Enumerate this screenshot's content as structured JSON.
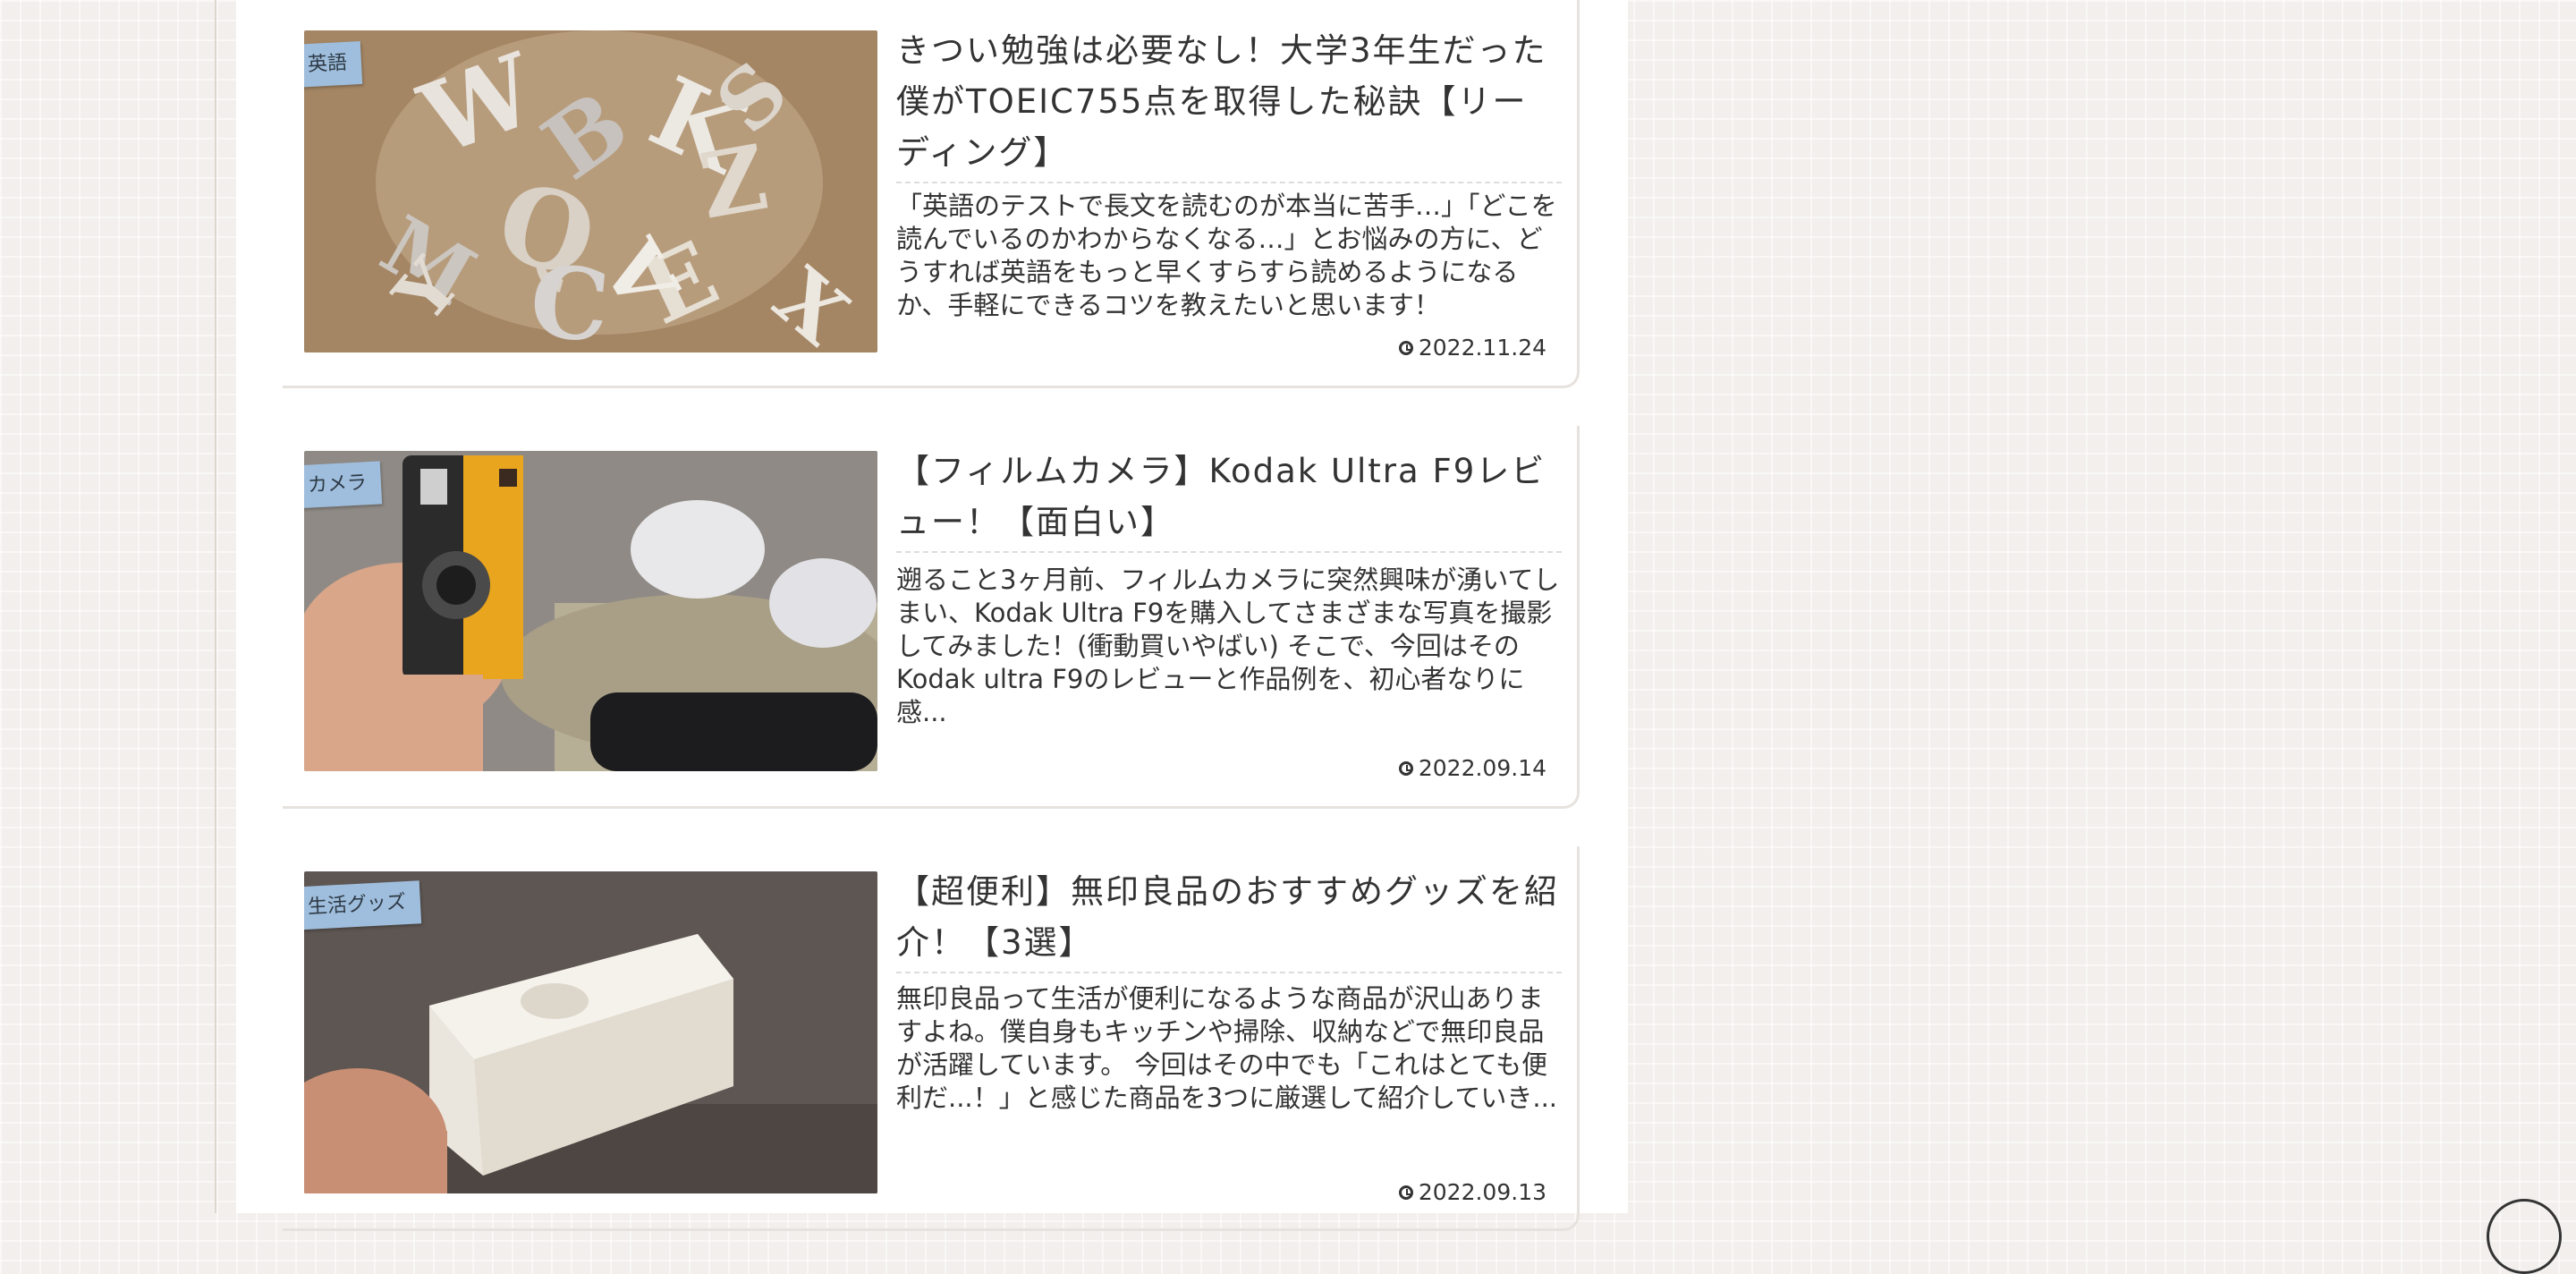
{
  "posts": [
    {
      "category": "英語",
      "title": "きつい勉強は必要なし！大学3年生だった僕がTOEIC755点を取得した秘訣【リーディング】",
      "snippet": "「英語のテストで長文を読むのが本当に苦手…」「どこを読んでいるのかわからなくなる…」とお悩みの方に、どうすれば英語をもっと早くすらすら読めるようになるか、手軽にできるコツを教えたいと思います！",
      "date": "2022.11.24",
      "image": "wooden-letters"
    },
    {
      "category": "カメラ",
      "title": "【フィルムカメラ】Kodak Ultra F9レビュー！【面白い】",
      "snippet": "遡ること3ヶ月前、フィルムカメラに突然興味が湧いてしまい、Kodak Ultra F9を購入してさまざまな写真を撮影してみました！(衝動買いやばい) そこで、今回はその Kodak ultra F9のレビューと作品例を、初心者なりに感...",
      "date": "2022.09.14",
      "image": "hand-holding-yellow-camera"
    },
    {
      "category": "生活グッズ",
      "title": "【超便利】無印良品のおすすめグッズを紹介！【3選】",
      "snippet": "無印良品って生活が便利になるような商品が沢山ありますよね。僕自身もキッチンや掃除、収納などで無印良品が活躍しています。 今回はその中でも「これはとても便利だ...！」と感じた商品を3つに厳選して紹介していき...",
      "date": "2022.09.13",
      "image": "white-storage-container"
    }
  ],
  "icons": {
    "date": "clock-icon",
    "corner": "scroll-top-button"
  },
  "colors": {
    "badge": "#9fbedd",
    "page_bg": "#f2efec",
    "content_bg": "#ffffff"
  }
}
